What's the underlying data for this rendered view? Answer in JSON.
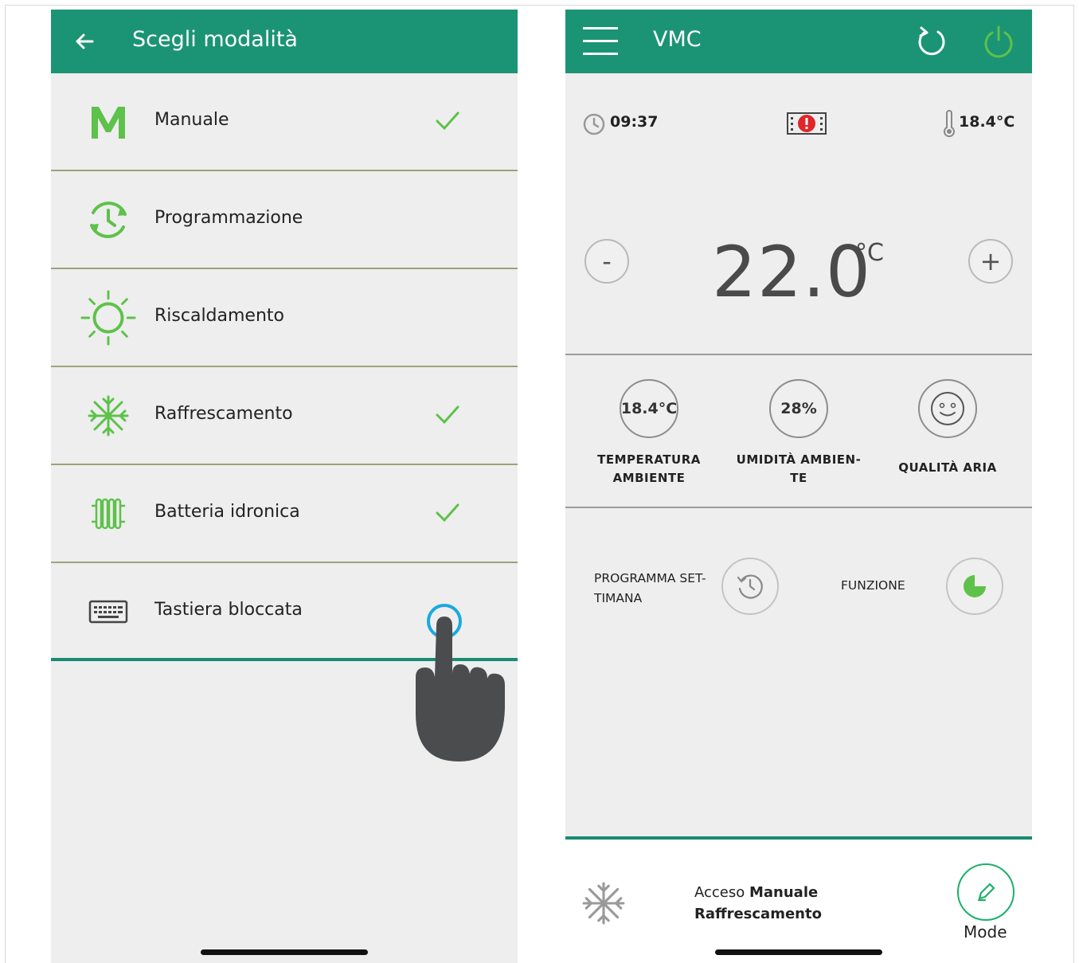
{
  "left_screen": {
    "header": {
      "title": "Scegli modalità"
    },
    "modes": [
      {
        "label": "Manuale",
        "icon": "m-letter-icon",
        "checked": true
      },
      {
        "label": "Programmazione",
        "icon": "schedule-clock-icon",
        "checked": false
      },
      {
        "label": "Riscaldamento",
        "icon": "sun-icon",
        "checked": false
      },
      {
        "label": "Raffrescamento",
        "icon": "snowflake-icon",
        "checked": true
      },
      {
        "label": "Batteria idronica",
        "icon": "radiator-icon",
        "checked": true
      },
      {
        "label": "Tastiera bloccata",
        "icon": "keyboard-icon",
        "checked": false
      }
    ]
  },
  "right_screen": {
    "header": {
      "title": "VMC"
    },
    "status": {
      "time": "09:37",
      "outside_temp": "18.4°C"
    },
    "setpoint": {
      "value": "22.0",
      "unit": "°C",
      "minus": "-",
      "plus": "+"
    },
    "sensors": [
      {
        "value": "18.4°C",
        "caption_1": "TEMPERATURA",
        "caption_2": "AMBIENTE"
      },
      {
        "value": "28%",
        "caption_1": "UMIDITÀ AMBIEN-",
        "caption_2": "TE"
      },
      {
        "value": "",
        "caption_1": "QUALITÀ ARIA",
        "caption_2": ""
      }
    ],
    "program": {
      "label_1": "PROGRAMMA SET-",
      "label_2": "TIMANA"
    },
    "function": {
      "label": "FUNZIONE"
    },
    "footer": {
      "status_prefix": "Acceso ",
      "status_mode": "Manuale",
      "status_line2": "Raffrescamento",
      "mode_button": "Mode"
    }
  },
  "colors": {
    "header_green": "#1b9475",
    "icon_green": "#5ec14a",
    "divider_olive": "#9fa17a",
    "background": "#edeeed"
  }
}
